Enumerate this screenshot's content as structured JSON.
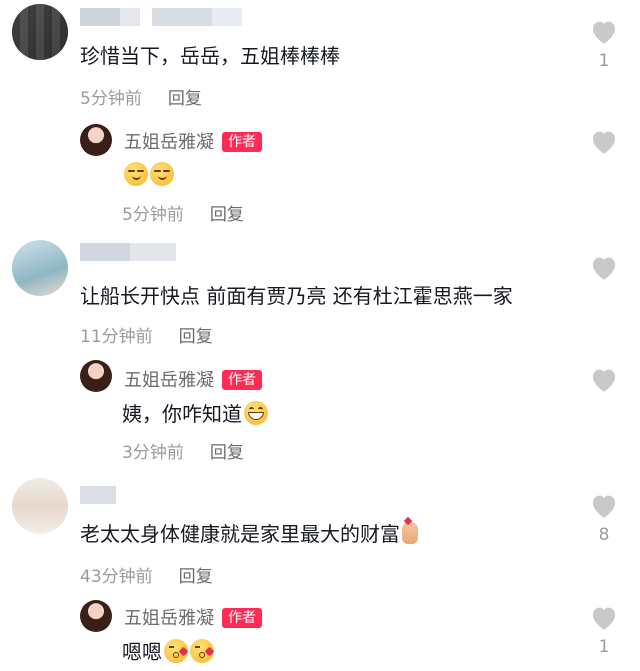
{
  "comments": [
    {
      "content": "珍惜当下，岳岳，五姐棒棒棒",
      "time": "5分钟前",
      "reply": "回复",
      "likes": "1"
    },
    {
      "content": "让船长开快点 前面有贾乃亮 还有杜江霍思燕一家",
      "time": "11分钟前",
      "reply": "回复",
      "likes": ""
    },
    {
      "content": "老太太身体健康就是家里最大的财富",
      "time": "43分钟前",
      "reply": "回复",
      "likes": "8"
    }
  ],
  "replies": [
    {
      "name": "五姐岳雅凝",
      "badge": "作者",
      "content": "",
      "emojis": [
        "smirk-emoji",
        "smirk-emoji"
      ],
      "time": "5分钟前",
      "reply": "回复",
      "likes": ""
    },
    {
      "name": "五姐岳雅凝",
      "badge": "作者",
      "content": "姨，你咋知道",
      "emojis": [
        "grin-emoji"
      ],
      "time": "3分钟前",
      "reply": "回复",
      "likes": ""
    },
    {
      "name": "五姐岳雅凝",
      "badge": "作者",
      "content": "嗯嗯",
      "emojis": [
        "kiss-emoji",
        "kiss-emoji"
      ],
      "likes": "1"
    }
  ],
  "icons": {
    "like": "heart-icon",
    "finger_heart": "finger-heart-icon"
  },
  "colors": {
    "badge": "#fe2c55",
    "meta_text": "#9a9ba1",
    "heart": "#c9c9cc"
  }
}
